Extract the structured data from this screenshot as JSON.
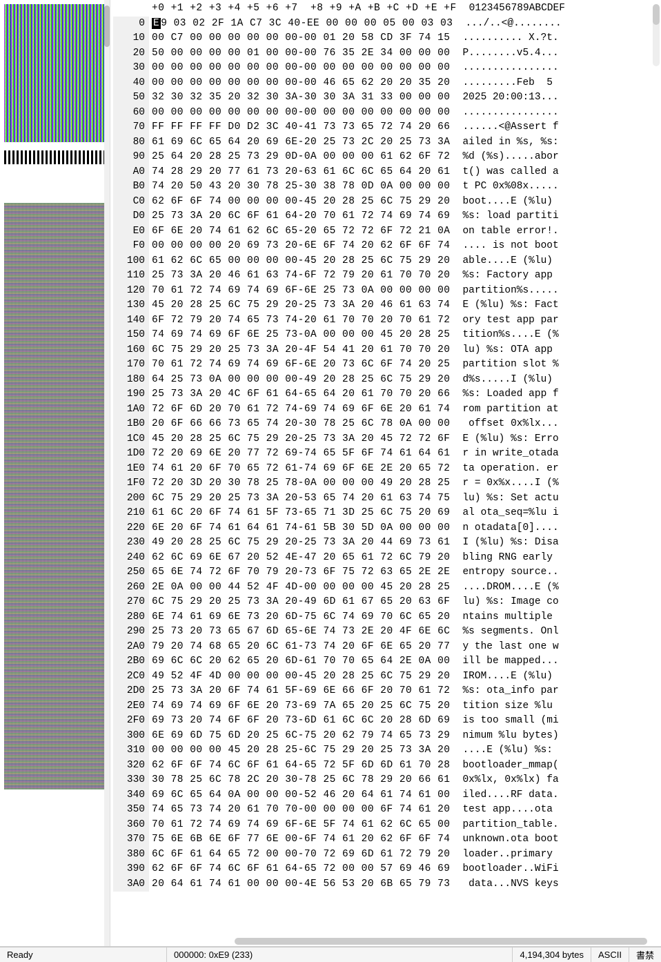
{
  "header": {
    "offsets_label": "",
    "columns": "+0 +1 +2 +3 +4 +5 +6 +7  +8 +9 +A +B +C +D +E +F",
    "ascii_label": "0123456789ABCDEF"
  },
  "rows": [
    {
      "off": "0",
      "hex": "E9 03 02 2F 1A C7 3C 40-EE 00 00 00 05 00 03 03",
      "asc": ".../..<@........",
      "cursor": true
    },
    {
      "off": "10",
      "hex": "00 C7 00 00 00 00 00 00-00 01 20 58 CD 3F 74 15",
      "asc": ".......... X.?t."
    },
    {
      "off": "20",
      "hex": "50 00 00 00 00 01 00 00-00 76 35 2E 34 00 00 00",
      "asc": "P........v5.4..."
    },
    {
      "off": "30",
      "hex": "00 00 00 00 00 00 00 00-00 00 00 00 00 00 00 00",
      "asc": "................"
    },
    {
      "off": "40",
      "hex": "00 00 00 00 00 00 00 00-00 46 65 62 20 20 35 20",
      "asc": ".........Feb  5 "
    },
    {
      "off": "50",
      "hex": "32 30 32 35 20 32 30 3A-30 30 3A 31 33 00 00 00",
      "asc": "2025 20:00:13..."
    },
    {
      "off": "60",
      "hex": "00 00 00 00 00 00 00 00-00 00 00 00 00 00 00 00",
      "asc": "................"
    },
    {
      "off": "70",
      "hex": "FF FF FF FF D0 D2 3C 40-41 73 73 65 72 74 20 66",
      "asc": "......<@Assert f"
    },
    {
      "off": "80",
      "hex": "61 69 6C 65 64 20 69 6E-20 25 73 2C 20 25 73 3A",
      "asc": "ailed in %s, %s:"
    },
    {
      "off": "90",
      "hex": "25 64 20 28 25 73 29 0D-0A 00 00 00 61 62 6F 72",
      "asc": "%d (%s).....abor"
    },
    {
      "off": "A0",
      "hex": "74 28 29 20 77 61 73 20-63 61 6C 6C 65 64 20 61",
      "asc": "t() was called a"
    },
    {
      "off": "B0",
      "hex": "74 20 50 43 20 30 78 25-30 38 78 0D 0A 00 00 00",
      "asc": "t PC 0x%08x....."
    },
    {
      "off": "C0",
      "hex": "62 6F 6F 74 00 00 00 00-45 20 28 25 6C 75 29 20",
      "asc": "boot....E (%lu) "
    },
    {
      "off": "D0",
      "hex": "25 73 3A 20 6C 6F 61 64-20 70 61 72 74 69 74 69",
      "asc": "%s: load partiti"
    },
    {
      "off": "E0",
      "hex": "6F 6E 20 74 61 62 6C 65-20 65 72 72 6F 72 21 0A",
      "asc": "on table error!."
    },
    {
      "off": "F0",
      "hex": "00 00 00 00 20 69 73 20-6E 6F 74 20 62 6F 6F 74",
      "asc": ".... is not boot"
    },
    {
      "off": "100",
      "hex": "61 62 6C 65 00 00 00 00-45 20 28 25 6C 75 29 20",
      "asc": "able....E (%lu) "
    },
    {
      "off": "110",
      "hex": "25 73 3A 20 46 61 63 74-6F 72 79 20 61 70 70 20",
      "asc": "%s: Factory app "
    },
    {
      "off": "120",
      "hex": "70 61 72 74 69 74 69 6F-6E 25 73 0A 00 00 00 00",
      "asc": "partition%s....."
    },
    {
      "off": "130",
      "hex": "45 20 28 25 6C 75 29 20-25 73 3A 20 46 61 63 74",
      "asc": "E (%lu) %s: Fact"
    },
    {
      "off": "140",
      "hex": "6F 72 79 20 74 65 73 74-20 61 70 70 20 70 61 72",
      "asc": "ory test app par"
    },
    {
      "off": "150",
      "hex": "74 69 74 69 6F 6E 25 73-0A 00 00 00 45 20 28 25",
      "asc": "tition%s....E (%"
    },
    {
      "off": "160",
      "hex": "6C 75 29 20 25 73 3A 20-4F 54 41 20 61 70 70 20",
      "asc": "lu) %s: OTA app "
    },
    {
      "off": "170",
      "hex": "70 61 72 74 69 74 69 6F-6E 20 73 6C 6F 74 20 25",
      "asc": "partition slot %"
    },
    {
      "off": "180",
      "hex": "64 25 73 0A 00 00 00 00-49 20 28 25 6C 75 29 20",
      "asc": "d%s.....I (%lu) "
    },
    {
      "off": "190",
      "hex": "25 73 3A 20 4C 6F 61 64-65 64 20 61 70 70 20 66",
      "asc": "%s: Loaded app f"
    },
    {
      "off": "1A0",
      "hex": "72 6F 6D 20 70 61 72 74-69 74 69 6F 6E 20 61 74",
      "asc": "rom partition at"
    },
    {
      "off": "1B0",
      "hex": "20 6F 66 66 73 65 74 20-30 78 25 6C 78 0A 00 00",
      "asc": " offset 0x%lx..."
    },
    {
      "off": "1C0",
      "hex": "45 20 28 25 6C 75 29 20-25 73 3A 20 45 72 72 6F",
      "asc": "E (%lu) %s: Erro"
    },
    {
      "off": "1D0",
      "hex": "72 20 69 6E 20 77 72 69-74 65 5F 6F 74 61 64 61",
      "asc": "r in write_otada"
    },
    {
      "off": "1E0",
      "hex": "74 61 20 6F 70 65 72 61-74 69 6F 6E 2E 20 65 72",
      "asc": "ta operation. er"
    },
    {
      "off": "1F0",
      "hex": "72 20 3D 20 30 78 25 78-0A 00 00 00 49 20 28 25",
      "asc": "r = 0x%x....I (%"
    },
    {
      "off": "200",
      "hex": "6C 75 29 20 25 73 3A 20-53 65 74 20 61 63 74 75",
      "asc": "lu) %s: Set actu"
    },
    {
      "off": "210",
      "hex": "61 6C 20 6F 74 61 5F 73-65 71 3D 25 6C 75 20 69",
      "asc": "al ota_seq=%lu i"
    },
    {
      "off": "220",
      "hex": "6E 20 6F 74 61 64 61 74-61 5B 30 5D 0A 00 00 00",
      "asc": "n otadata[0]...."
    },
    {
      "off": "230",
      "hex": "49 20 28 25 6C 75 29 20-25 73 3A 20 44 69 73 61",
      "asc": "I (%lu) %s: Disa"
    },
    {
      "off": "240",
      "hex": "62 6C 69 6E 67 20 52 4E-47 20 65 61 72 6C 79 20",
      "asc": "bling RNG early "
    },
    {
      "off": "250",
      "hex": "65 6E 74 72 6F 70 79 20-73 6F 75 72 63 65 2E 2E",
      "asc": "entropy source.."
    },
    {
      "off": "260",
      "hex": "2E 0A 00 00 44 52 4F 4D-00 00 00 00 45 20 28 25",
      "asc": "....DROM....E (%"
    },
    {
      "off": "270",
      "hex": "6C 75 29 20 25 73 3A 20-49 6D 61 67 65 20 63 6F",
      "asc": "lu) %s: Image co"
    },
    {
      "off": "280",
      "hex": "6E 74 61 69 6E 73 20 6D-75 6C 74 69 70 6C 65 20",
      "asc": "ntains multiple "
    },
    {
      "off": "290",
      "hex": "25 73 20 73 65 67 6D 65-6E 74 73 2E 20 4F 6E 6C",
      "asc": "%s segments. Onl"
    },
    {
      "off": "2A0",
      "hex": "79 20 74 68 65 20 6C 61-73 74 20 6F 6E 65 20 77",
      "asc": "y the last one w"
    },
    {
      "off": "2B0",
      "hex": "69 6C 6C 20 62 65 20 6D-61 70 70 65 64 2E 0A 00",
      "asc": "ill be mapped..."
    },
    {
      "off": "2C0",
      "hex": "49 52 4F 4D 00 00 00 00-45 20 28 25 6C 75 29 20",
      "asc": "IROM....E (%lu) "
    },
    {
      "off": "2D0",
      "hex": "25 73 3A 20 6F 74 61 5F-69 6E 66 6F 20 70 61 72",
      "asc": "%s: ota_info par"
    },
    {
      "off": "2E0",
      "hex": "74 69 74 69 6F 6E 20 73-69 7A 65 20 25 6C 75 20",
      "asc": "tition size %lu "
    },
    {
      "off": "2F0",
      "hex": "69 73 20 74 6F 6F 20 73-6D 61 6C 6C 20 28 6D 69",
      "asc": "is too small (mi"
    },
    {
      "off": "300",
      "hex": "6E 69 6D 75 6D 20 25 6C-75 20 62 79 74 65 73 29",
      "asc": "nimum %lu bytes)"
    },
    {
      "off": "310",
      "hex": "00 00 00 00 45 20 28 25-6C 75 29 20 25 73 3A 20",
      "asc": "....E (%lu) %s: "
    },
    {
      "off": "320",
      "hex": "62 6F 6F 74 6C 6F 61 64-65 72 5F 6D 6D 61 70 28",
      "asc": "bootloader_mmap("
    },
    {
      "off": "330",
      "hex": "30 78 25 6C 78 2C 20 30-78 25 6C 78 29 20 66 61",
      "asc": "0x%lx, 0x%lx) fa"
    },
    {
      "off": "340",
      "hex": "69 6C 65 64 0A 00 00 00-52 46 20 64 61 74 61 00",
      "asc": "iled....RF data."
    },
    {
      "off": "350",
      "hex": "74 65 73 74 20 61 70 70-00 00 00 00 6F 74 61 20",
      "asc": "test app....ota "
    },
    {
      "off": "360",
      "hex": "70 61 72 74 69 74 69 6F-6E 5F 74 61 62 6C 65 00",
      "asc": "partition_table."
    },
    {
      "off": "370",
      "hex": "75 6E 6B 6E 6F 77 6E 00-6F 74 61 20 62 6F 6F 74",
      "asc": "unknown.ota boot"
    },
    {
      "off": "380",
      "hex": "6C 6F 61 64 65 72 00 00-70 72 69 6D 61 72 79 20",
      "asc": "loader..primary "
    },
    {
      "off": "390",
      "hex": "62 6F 6F 74 6C 6F 61 64-65 72 00 00 57 69 46 69",
      "asc": "bootloader..WiFi"
    },
    {
      "off": "3A0",
      "hex": "20 64 61 74 61 00 00 00-4E 56 53 20 6B 65 79 73",
      "asc": " data...NVS keys"
    }
  ],
  "status": {
    "ready": "Ready",
    "position": "000000: 0xE9 (233)",
    "filesize": "4,194,304 bytes",
    "encoding": "ASCII",
    "mode": "書禁"
  }
}
